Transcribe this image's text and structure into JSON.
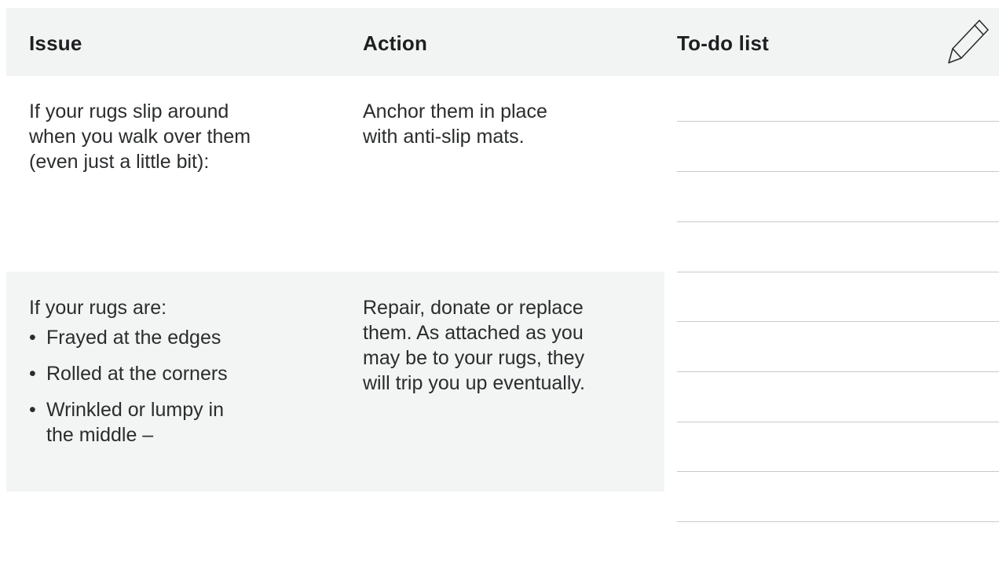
{
  "headers": {
    "issue": "Issue",
    "action": "Action",
    "todo": "To-do list",
    "icon": "pencil-icon"
  },
  "rows": [
    {
      "issue_lines": [
        "If your rugs slip around",
        "when you walk over them",
        "(even just a little bit):"
      ],
      "action_lines": [
        "Anchor them in place",
        "with anti-slip mats."
      ]
    },
    {
      "issue_intro": "If your rugs are:",
      "issue_bullets": [
        {
          "bullet": "•",
          "lines": [
            "Frayed at the edges"
          ]
        },
        {
          "bullet": "•",
          "lines": [
            "Rolled at the corners"
          ]
        },
        {
          "bullet": "•",
          "lines": [
            "Wrinkled or lumpy in",
            "the middle –"
          ]
        }
      ],
      "action_lines": [
        "Repair, donate or replace",
        "them. As attached as you",
        "may be to your rugs, they",
        "will trip you up eventually."
      ]
    }
  ],
  "colors": {
    "header_background": "#f2f4f3",
    "row_highlight": "#f3f5f4",
    "rule_line": "#c8cacc",
    "text": "#2a2c2e"
  }
}
